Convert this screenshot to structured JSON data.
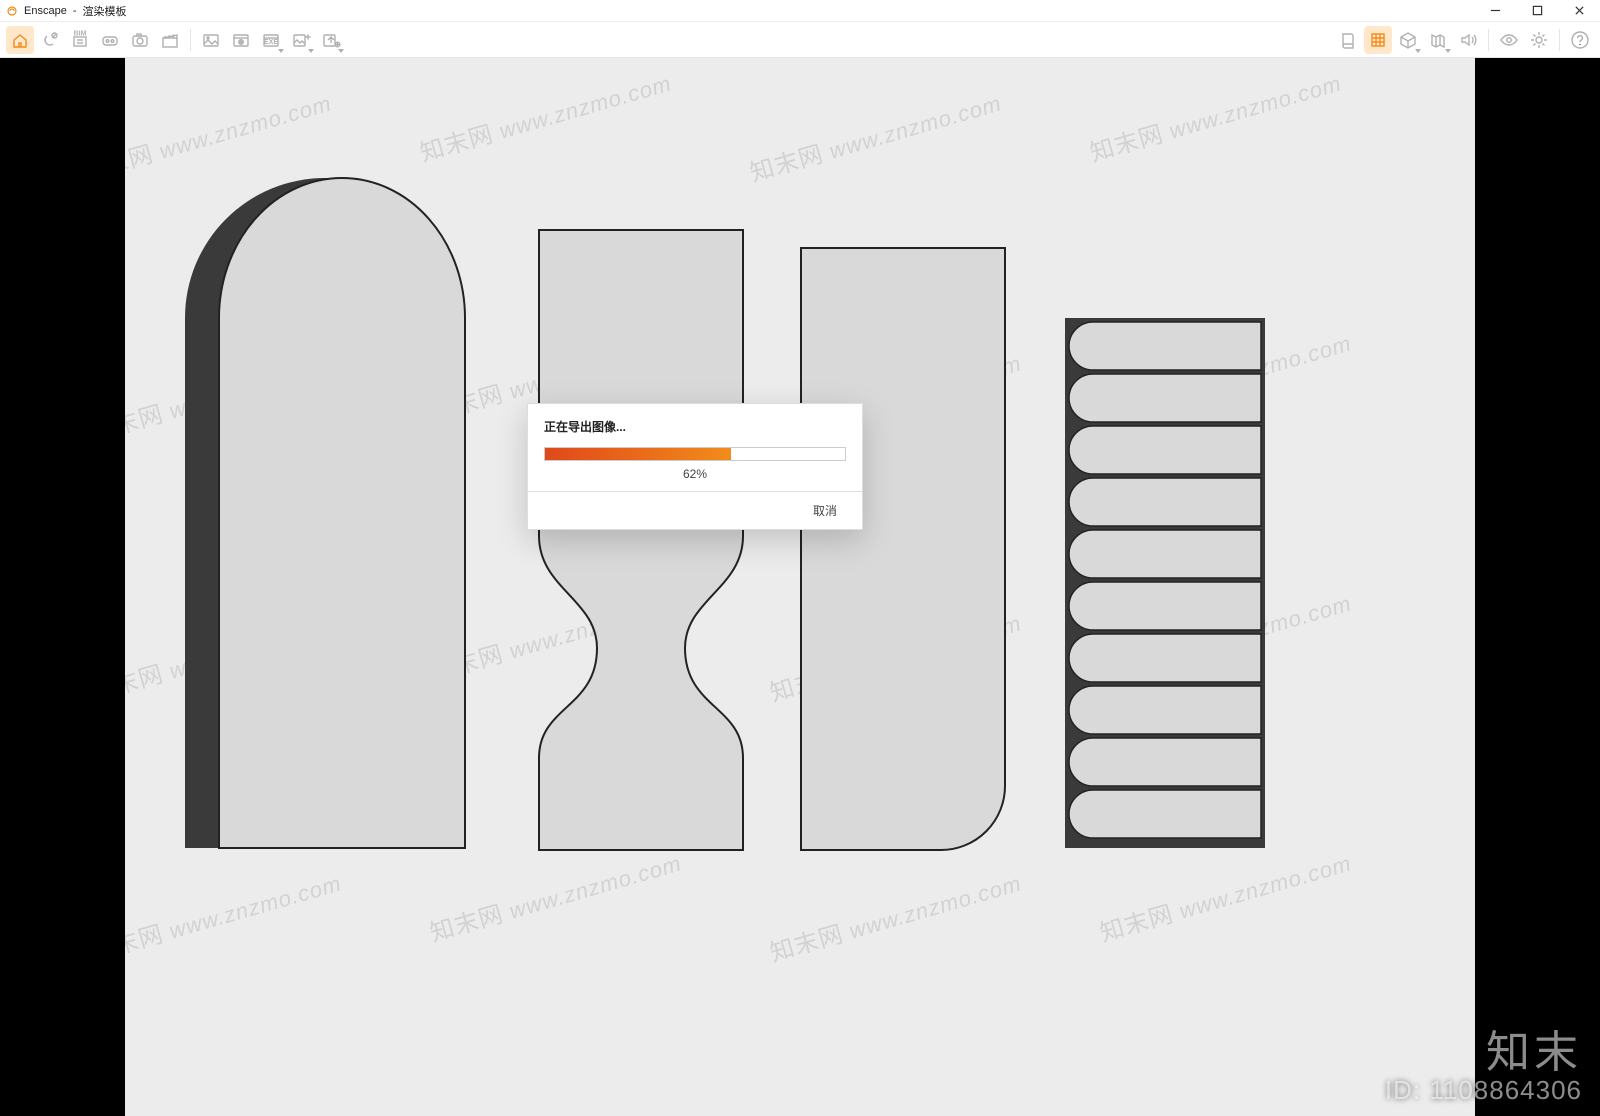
{
  "window": {
    "app_name": "Enscape",
    "title_suffix": "渲染模板"
  },
  "toolbar": {
    "left": [
      {
        "name": "walk-mode",
        "icon": "home",
        "active": true,
        "dd": false
      },
      {
        "name": "orbit-mode",
        "icon": "compass",
        "active": false,
        "dd": false
      },
      {
        "name": "bim-manage",
        "icon": "bim",
        "active": false,
        "dd": false
      },
      {
        "name": "vr",
        "icon": "vr-goggles",
        "active": false,
        "dd": false
      },
      {
        "name": "screenshot",
        "icon": "camera",
        "active": false,
        "dd": false
      },
      {
        "name": "video",
        "icon": "clapboard",
        "active": false,
        "dd": false
      },
      {
        "sep": true
      },
      {
        "name": "panorama",
        "icon": "pano",
        "active": false,
        "dd": false
      },
      {
        "name": "web-standalone",
        "icon": "web",
        "active": false,
        "dd": false
      },
      {
        "name": "exe-standalone",
        "icon": "exe",
        "active": false,
        "dd": true
      },
      {
        "name": "export-image",
        "icon": "img-export",
        "active": false,
        "dd": true
      },
      {
        "name": "export-more",
        "icon": "export-add",
        "active": false,
        "dd": true
      }
    ],
    "right": [
      {
        "name": "asset-library",
        "icon": "book",
        "active": false,
        "dd": false
      },
      {
        "name": "site-context",
        "icon": "grid",
        "active": true,
        "dd": false
      },
      {
        "name": "orthographic",
        "icon": "cube",
        "active": false,
        "dd": true
      },
      {
        "name": "map-mode",
        "icon": "map",
        "active": false,
        "dd": true
      },
      {
        "name": "sound",
        "icon": "speaker",
        "active": false,
        "dd": false
      },
      {
        "sep": true
      },
      {
        "name": "visual-presets",
        "icon": "eye",
        "active": false,
        "dd": false
      },
      {
        "name": "settings",
        "icon": "gear",
        "active": false,
        "dd": false
      },
      {
        "sep": true
      },
      {
        "name": "help",
        "icon": "help",
        "active": false,
        "dd": false
      }
    ]
  },
  "dialog": {
    "title": "正在导出图像...",
    "percent": 62,
    "percent_label": "62%",
    "cancel_label": "取消"
  },
  "watermark": {
    "cn": "知末网",
    "url": "www.znzmo.com"
  },
  "footer": {
    "brand": "知末",
    "id_label": "ID: 1108864306"
  }
}
